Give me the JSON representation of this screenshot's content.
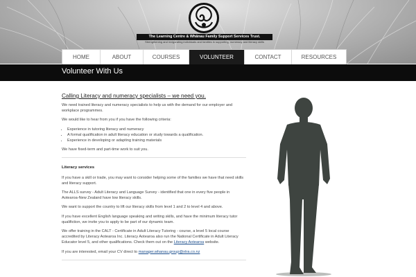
{
  "header": {
    "org_title": "The Learning Centre & Whānau Family Support Services Trust.",
    "tagline": "Strengthening and invigorating individuals and families in supporting, numeracy and literacy skills"
  },
  "nav": {
    "items": [
      {
        "label": "HOME",
        "active": false
      },
      {
        "label": "ABOUT",
        "active": false
      },
      {
        "label": "COURSES",
        "active": false
      },
      {
        "label": "VOLUNTEER",
        "active": true
      },
      {
        "label": "CONTACT",
        "active": false
      },
      {
        "label": "RESOURCES",
        "active": false
      }
    ]
  },
  "page": {
    "title": "Volunteer With Us"
  },
  "content": {
    "heading": "Calling Literacy and numeracy specialists – we need you.",
    "intro": "We need trained literacy and numeracy specialists to help us with the demand for our employer and workplace programmes.",
    "criteria_intro": "We would like to hear from you if you have the following criteria:",
    "criteria": [
      "Experience in tutoring literacy and numeracy",
      "A formal qualification in adult literacy education or study towards a qualification.",
      "Experience in developing or adapting training materials"
    ],
    "work_types": "We have fixed-term and part-time work to suit you.",
    "section_title": "Literacy services",
    "p1": "If you have a skill or trade, you may want to consider helping some of the families we have that need skills and literacy support.",
    "p2": "The ALLS survey - Adult Literacy and Language Survey - identified that one in every five people in Aotearoa-New Zealand have low literacy skills.",
    "p3": "We want to support the country to lift our literacy skills from level 1 and 2 to level 4 and above.",
    "p4": "If you have excellent English language speaking and writing skills, and have the minimum literacy tutor qualifiction, we invite you to apply to be part of our dynamic team.",
    "p5_before": "We offer training in the CALT - Certificate in Adult Literacy Tutoring - course, a level 5 local course accredited by Literacy Aotearoa Inc. Literacy Aotearoa also run the National Certificate in Adult Literacy Educator level 5, and other qualifications. Check them out on the ",
    "p5_link": "Literacy Aotearoa",
    "p5_after": " website.",
    "p6_before": "If you are interested, email your CV direct to ",
    "email": "manager.whanau.group@xtra.co.nz"
  },
  "colors": {
    "nav_active_bg": "#1b1b1b",
    "titlebar_bg": "#0c0c0c",
    "link": "#1a4d8c"
  },
  "icons": {
    "logo": "koru-circle-logo",
    "hero": "standing-person-silhouette"
  }
}
